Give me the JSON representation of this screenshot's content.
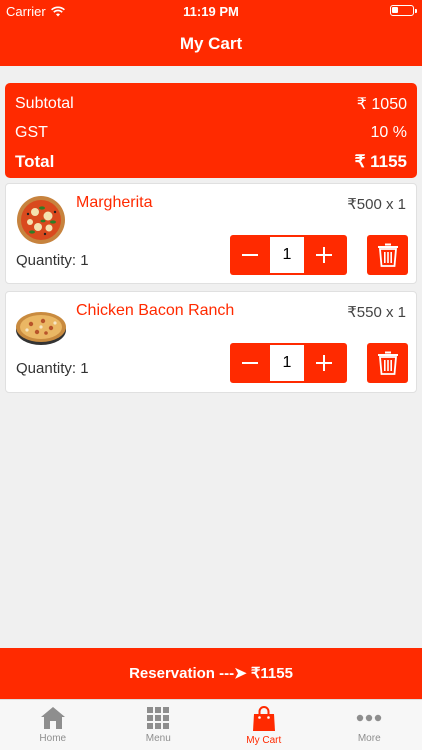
{
  "status_bar": {
    "carrier": "Carrier",
    "time": "11:19 PM",
    "battery_level": 0.3
  },
  "nav": {
    "title": "My Cart"
  },
  "summary": {
    "subtotal_label": "Subtotal",
    "subtotal_value": "₹ 1050",
    "gst_label": "GST",
    "gst_value": "10 %",
    "total_label": "Total",
    "total_value": "₹ 1155"
  },
  "items": [
    {
      "name": "Margherita",
      "price": "₹500 x 1",
      "quantity_label": "Quantity: 1",
      "quantity": "1"
    },
    {
      "name": "Chicken Bacon Ranch",
      "price": "₹550 x 1",
      "quantity_label": "Quantity: 1",
      "quantity": "1"
    }
  ],
  "reservation": {
    "label": "Reservation ---➤ ₹1155"
  },
  "tabs": [
    {
      "label": "Home",
      "icon": "home-icon"
    },
    {
      "label": "Menu",
      "icon": "grid-icon"
    },
    {
      "label": "My Cart",
      "icon": "shopping-bag-icon",
      "active": true
    },
    {
      "label": "More",
      "icon": "more-dots-icon"
    }
  ],
  "colors": {
    "accent": "#ff2a00",
    "inactive_tab": "#8e8e8e"
  }
}
